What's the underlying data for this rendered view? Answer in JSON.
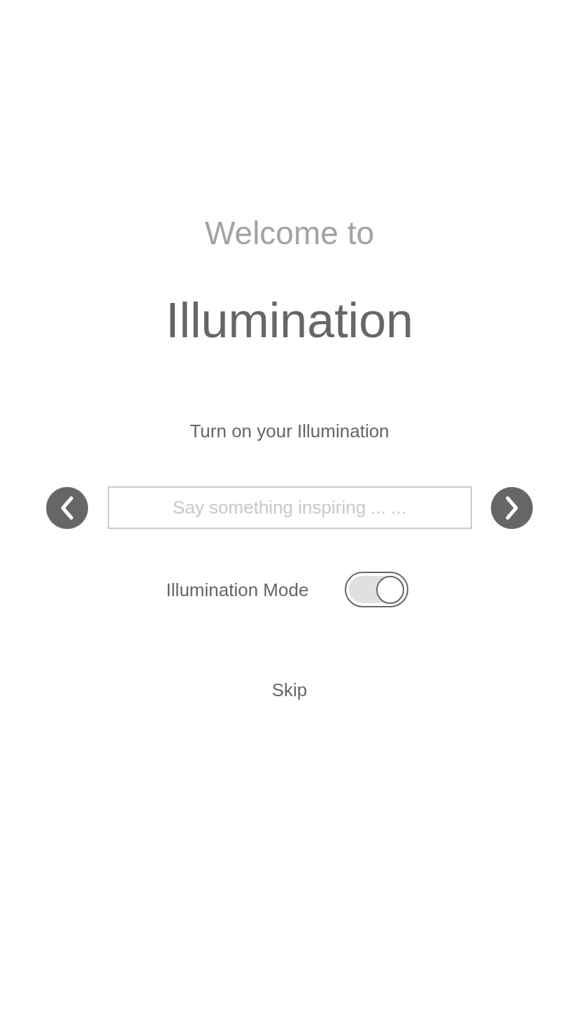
{
  "greeting": "Welcome to",
  "app_name": "Illumination",
  "subtitle": "Turn on your Illumination",
  "message_field": {
    "placeholder": "Say something inspiring ... ..."
  },
  "mode_toggle": {
    "label": "Illumination Mode",
    "on": true
  },
  "skip": "Skip"
}
